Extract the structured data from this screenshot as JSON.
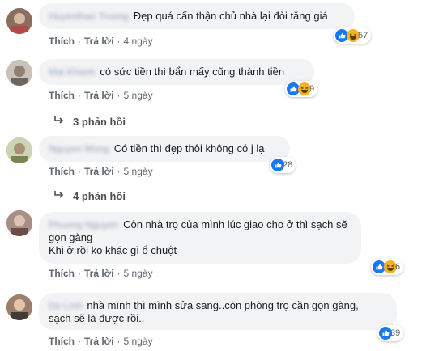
{
  "comments": [
    {
      "author": "Huyenthao Truong",
      "text_lines": [
        "Đẹp quá cẩn thận chủ nhà lại đòi tăng giá"
      ],
      "like": "Thích",
      "reply": "Trả lời",
      "time": "4 ngày",
      "reaction_count": "57",
      "reactions": [
        "like",
        "haha"
      ]
    },
    {
      "author": "Mai Khanh",
      "text_lines": [
        "có sức tiền thì bẩn mấy cũng thành tiền"
      ],
      "like": "Thích",
      "reply": "Trả lời",
      "time": "5 ngày",
      "reaction_count": "9",
      "reactions": [
        "like",
        "haha"
      ],
      "replies_label": "3 phản hồi"
    },
    {
      "author": "Nguyen Mong",
      "text_lines": [
        "Có tiền thì đẹp thôi không có j lạ"
      ],
      "like": "Thích",
      "reply": "Trả lời",
      "time": "5 ngày",
      "reaction_count": "28",
      "reactions": [
        "like"
      ],
      "replies_label": "4 phản hồi"
    },
    {
      "author": "Phuong Nguyen",
      "text_lines": [
        "Còn nhà trọ của mình lúc giao cho ở thì sạch sẽ",
        "gọn gàng",
        "Khi ở rồi ko khác gì ổ chuột"
      ],
      "like": "Thích",
      "reply": "Trả lời",
      "time": "5 ngày",
      "reaction_count": "6",
      "reactions": [
        "like",
        "haha"
      ]
    },
    {
      "author": "Do Linh",
      "text_lines": [
        "nhà mình thì mình sửa sang..còn phòng trọ cần gọn gàng,",
        "sạch sẽ là được rồi.."
      ],
      "like": "Thích",
      "reply": "Trả lời",
      "time": "5 ngày",
      "reaction_count": "39",
      "reactions": [
        "like"
      ]
    }
  ],
  "colors": {
    "like_blue": "#1877f2",
    "haha_yellow": "#f7b125",
    "bubble_bg": "#f2f3f5",
    "meta_text": "#606770"
  },
  "icons": {
    "like": "thumbs-up-icon",
    "haha": "laughing-face-icon",
    "reply_arrow": "reply-arrow-icon"
  }
}
